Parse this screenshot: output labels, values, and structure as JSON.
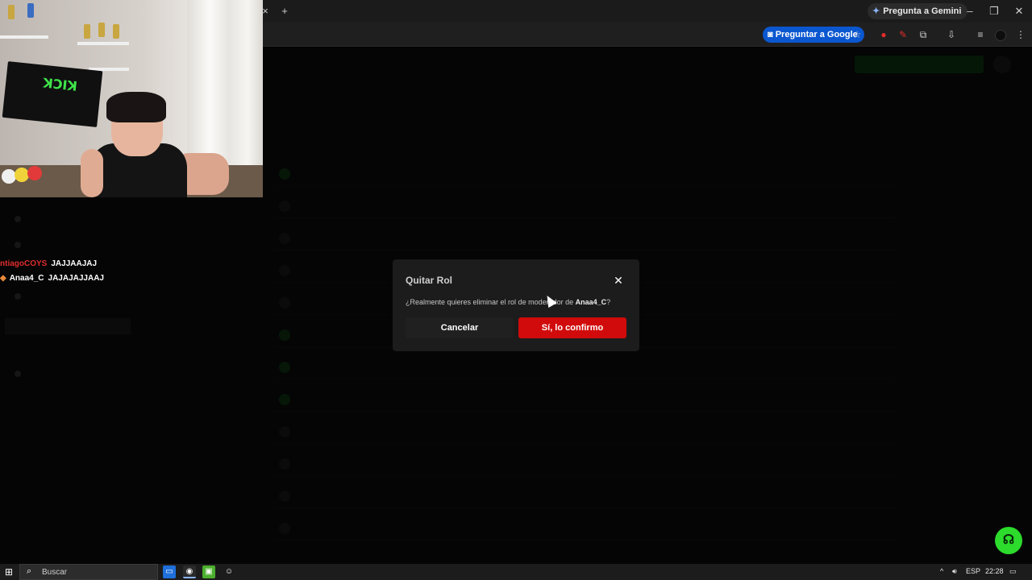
{
  "browser": {
    "gemini_label": "Pregunta a Gemini",
    "google_ask_label": "Preguntar a Google",
    "new_tab_glyph": "+",
    "close_tab_glyph": "×"
  },
  "chat": {
    "messages": [
      {
        "user": "ntiagoCOYS",
        "text": "JAJJAAJAJ"
      },
      {
        "user": "Anaa4_C",
        "text": "JAJAJAJJAAJ"
      }
    ]
  },
  "webcam": {
    "banner_text": "KICK"
  },
  "modal": {
    "title": "Quitar Rol",
    "message_prefix": "¿Realmente quieres eliminar el rol de moderador de ",
    "username": "Anaa4_C",
    "message_suffix": "?",
    "cancel_label": "Cancelar",
    "confirm_label": "Sí, lo confirmo"
  },
  "taskbar": {
    "search_placeholder": "Buscar",
    "language": "ESP",
    "time": "22:28"
  },
  "colors": {
    "confirm_button": "#d10b0b",
    "help_button": "#2cdb2c",
    "google_pill": "#0b57d0",
    "chat_user_red": "#e02c2c"
  }
}
